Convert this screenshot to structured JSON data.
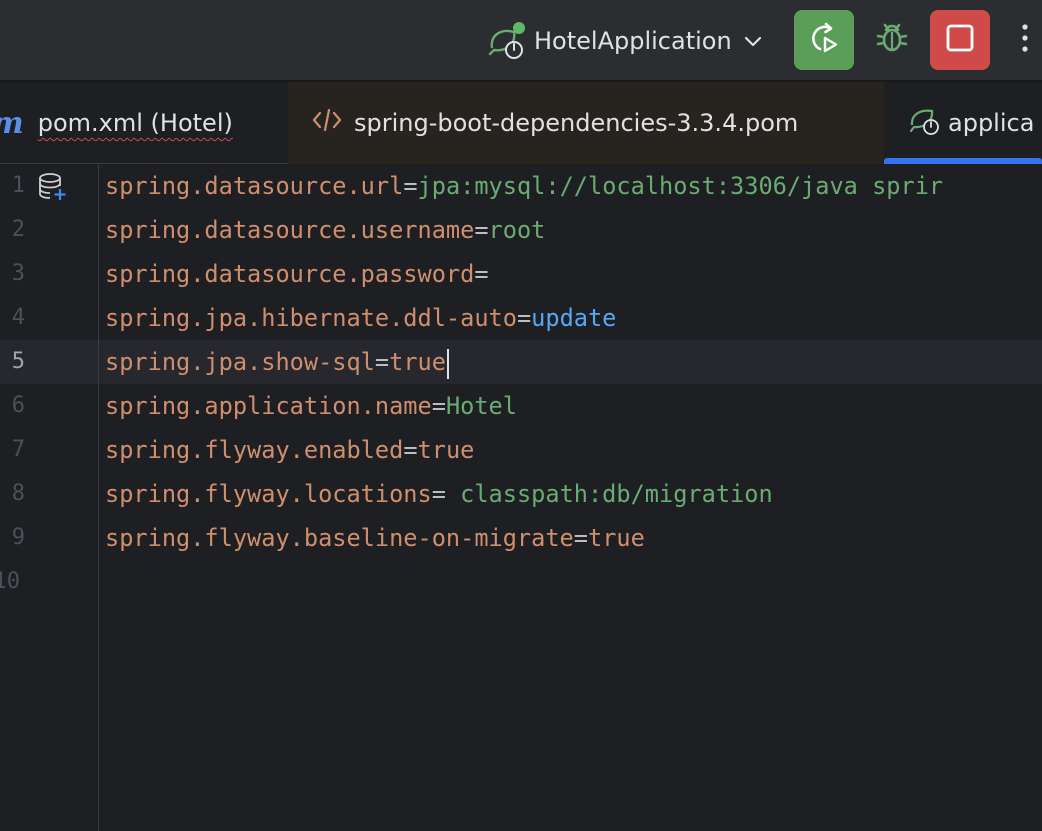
{
  "toolbar": {
    "run_config_label": "HotelApplication",
    "run_config_icon": "spring-boot-run-icon",
    "rerun_icon": "rerun-icon",
    "debug_icon": "debug-bug-icon",
    "stop_icon": "stop-icon",
    "more_icon": "more-vertical-icon",
    "colors": {
      "rerun": "#5b9e5a",
      "stop": "#d04a4a",
      "accent": "#3574f0"
    }
  },
  "tabs": [
    {
      "label": "pom.xml (Hotel)",
      "icon": "maven-icon",
      "icon_glyph": "m"
    },
    {
      "label": "spring-boot-dependencies-3.3.4.pom",
      "icon": "xml-code-icon"
    },
    {
      "label": "applica",
      "icon": "spring-boot-file-icon",
      "active": true
    }
  ],
  "editor": {
    "current_line": 5,
    "lines": [
      {
        "num": "1",
        "key": "spring.datasource.url",
        "sep": "=",
        "value": "jpa:mysql://localhost:3306/java sprir",
        "value_style": "green"
      },
      {
        "num": "2",
        "key": "spring.datasource.username",
        "sep": "=",
        "value": "root",
        "value_style": "green"
      },
      {
        "num": "3",
        "key": "spring.datasource.password",
        "sep": "=",
        "value": "",
        "value_style": "green"
      },
      {
        "num": "4",
        "key": "spring.jpa.hibernate.ddl-auto",
        "sep": "=",
        "value": "update",
        "value_style": "blue"
      },
      {
        "num": "5",
        "key": "spring.jpa.show-sql",
        "sep": "=",
        "value": "true",
        "value_style": "orange"
      },
      {
        "num": "6",
        "key": "spring.application.name",
        "sep": "=",
        "value": "Hotel",
        "value_style": "green"
      },
      {
        "num": "7",
        "key": "spring.flyway.enabled",
        "sep": "=",
        "value": "true",
        "value_style": "orange"
      },
      {
        "num": "8",
        "key": "spring.flyway.locations",
        "sep": "= ",
        "value": "classpath:db/migration",
        "value_style": "green"
      },
      {
        "num": "9",
        "key": "spring.flyway.baseline-on-migrate",
        "sep": "=",
        "value": "true",
        "value_style": "orange"
      },
      {
        "num": "10",
        "key": "",
        "sep": "",
        "value": "",
        "value_style": "green"
      }
    ],
    "gutter_icon": "database-add-icon"
  }
}
